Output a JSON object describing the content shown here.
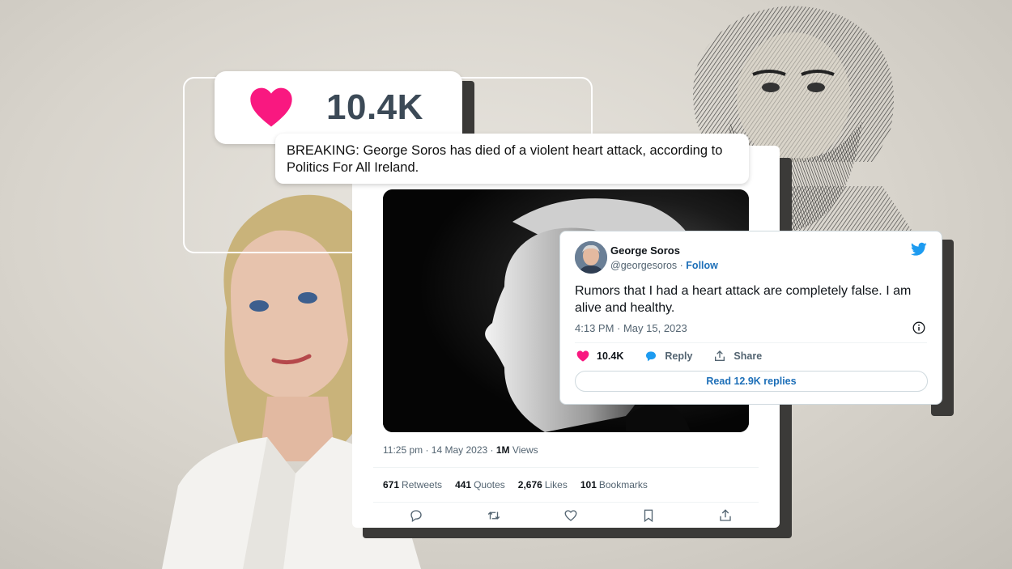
{
  "like_badge": {
    "count": "10.4K"
  },
  "banner": {
    "text": "BREAKING: George Soros has died of a violent heart attack, according to Politics For All Ireland."
  },
  "tweet": {
    "time": "11:25 pm · 14 May 2023 · ",
    "views_count": "1M",
    "views_label": " Views",
    "stats": [
      {
        "count": "671",
        "label": "Retweets"
      },
      {
        "count": "441",
        "label": "Quotes"
      },
      {
        "count": "2,676",
        "label": "Likes"
      },
      {
        "count": "101",
        "label": "Bookmarks"
      }
    ],
    "actions": [
      "reply-icon",
      "retweet-icon",
      "like-icon",
      "bookmark-icon",
      "share-icon"
    ]
  },
  "soros_tweet": {
    "name": "George Soros",
    "handle": "@georgesoros",
    "dot": " · ",
    "follow": "Follow",
    "text": "Rumors that I had a heart attack are completely false. I am alive and healthy.",
    "timestamp": "4:13 PM · May 15, 2023",
    "likes": "10.4K",
    "reply": "Reply",
    "share": "Share",
    "replies_button": "Read 12.9K replies"
  },
  "colors": {
    "heart": "#f91880",
    "link_blue": "#1d6fb8",
    "twitter_blue": "#1d9bf0",
    "background": "#d8d4cc"
  }
}
